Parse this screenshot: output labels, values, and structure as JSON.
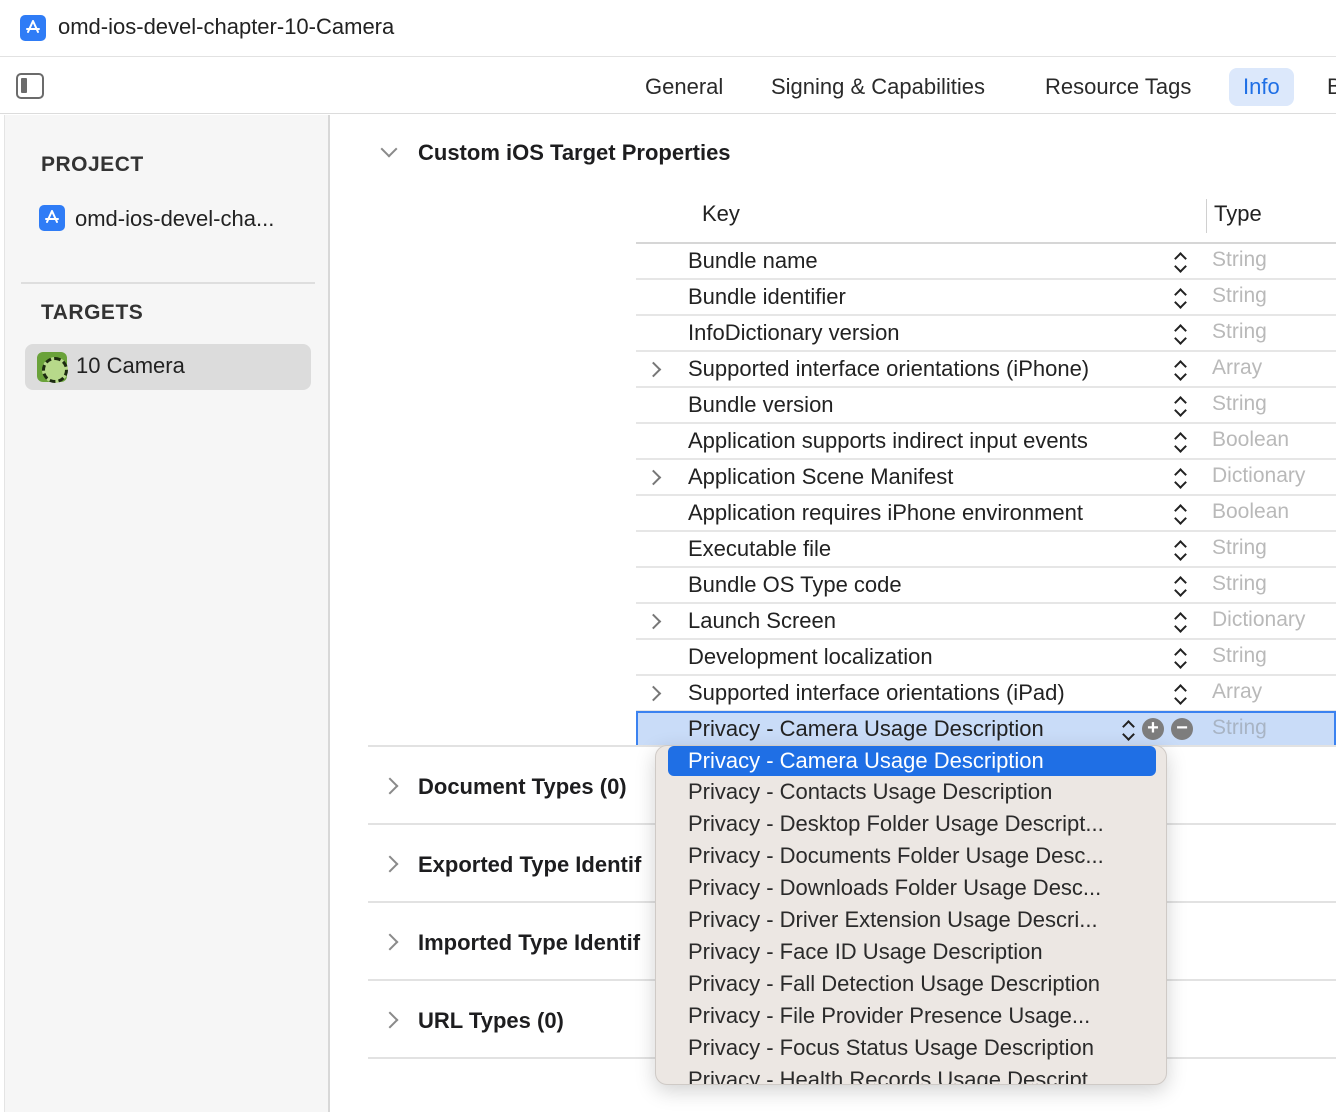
{
  "window": {
    "title": "omd-ios-devel-chapter-10-Camera"
  },
  "tabs": [
    {
      "label": "General"
    },
    {
      "label": "Signing & Capabilities"
    },
    {
      "label": "Resource Tags"
    },
    {
      "label": "Info",
      "active": true
    },
    {
      "label": "B"
    }
  ],
  "sidebar": {
    "project_header": "PROJECT",
    "project_item": "omd-ios-devel-cha...",
    "targets_header": "TARGETS",
    "target_item": "10 Camera"
  },
  "main": {
    "section_title": "Custom iOS Target Properties",
    "columns": {
      "key": "Key",
      "type": "Type"
    },
    "rows": [
      {
        "key": "Bundle name",
        "type": "String"
      },
      {
        "key": "Bundle identifier",
        "type": "String"
      },
      {
        "key": "InfoDictionary version",
        "type": "String"
      },
      {
        "key": "Supported interface orientations (iPhone)",
        "type": "Array"
      },
      {
        "key": "Bundle version",
        "type": "String"
      },
      {
        "key": "Application supports indirect input events",
        "type": "Boolean"
      },
      {
        "key": "Application Scene Manifest",
        "type": "Dictionary"
      },
      {
        "key": "Application requires iPhone environment",
        "type": "Boolean"
      },
      {
        "key": "Executable file",
        "type": "String"
      },
      {
        "key": "Bundle OS Type code",
        "type": "String"
      },
      {
        "key": "Launch Screen",
        "type": "Dictionary"
      },
      {
        "key": "Development localization",
        "type": "String"
      },
      {
        "key": "Supported interface orientations (iPad)",
        "type": "Array"
      },
      {
        "key": "Privacy - Camera Usage Description",
        "type": "String"
      }
    ],
    "sections": [
      {
        "title": "Document Types (0)"
      },
      {
        "title": "Exported Type Identif"
      },
      {
        "title": "Imported Type Identif"
      },
      {
        "title": "URL Types (0)"
      }
    ],
    "add_button": "+",
    "remove_button": "−"
  },
  "dropdown": {
    "options": [
      "Privacy - Camera Usage Description",
      "Privacy - Contacts Usage Description",
      "Privacy - Desktop Folder Usage Descript...",
      "Privacy - Documents Folder Usage Desc...",
      "Privacy - Downloads Folder Usage Desc...",
      "Privacy - Driver Extension Usage Descri...",
      "Privacy - Face ID Usage Description",
      "Privacy - Fall Detection Usage Description",
      "Privacy - File Provider Presence Usage...",
      "Privacy - Focus Status Usage Description",
      "Privacy - Health Records Usage Descript..."
    ]
  },
  "colors": {
    "accent": "#1f6fe5",
    "selected_row": "#c9dcf8",
    "muted_type": "#b9b9b9"
  },
  "icons": [
    "app-store-icon",
    "sidebar-toggle-icon",
    "camera-target-icon",
    "chevron-down-icon",
    "chevron-right-icon",
    "stepper-icon",
    "plus-circle-icon",
    "minus-circle-icon"
  ]
}
